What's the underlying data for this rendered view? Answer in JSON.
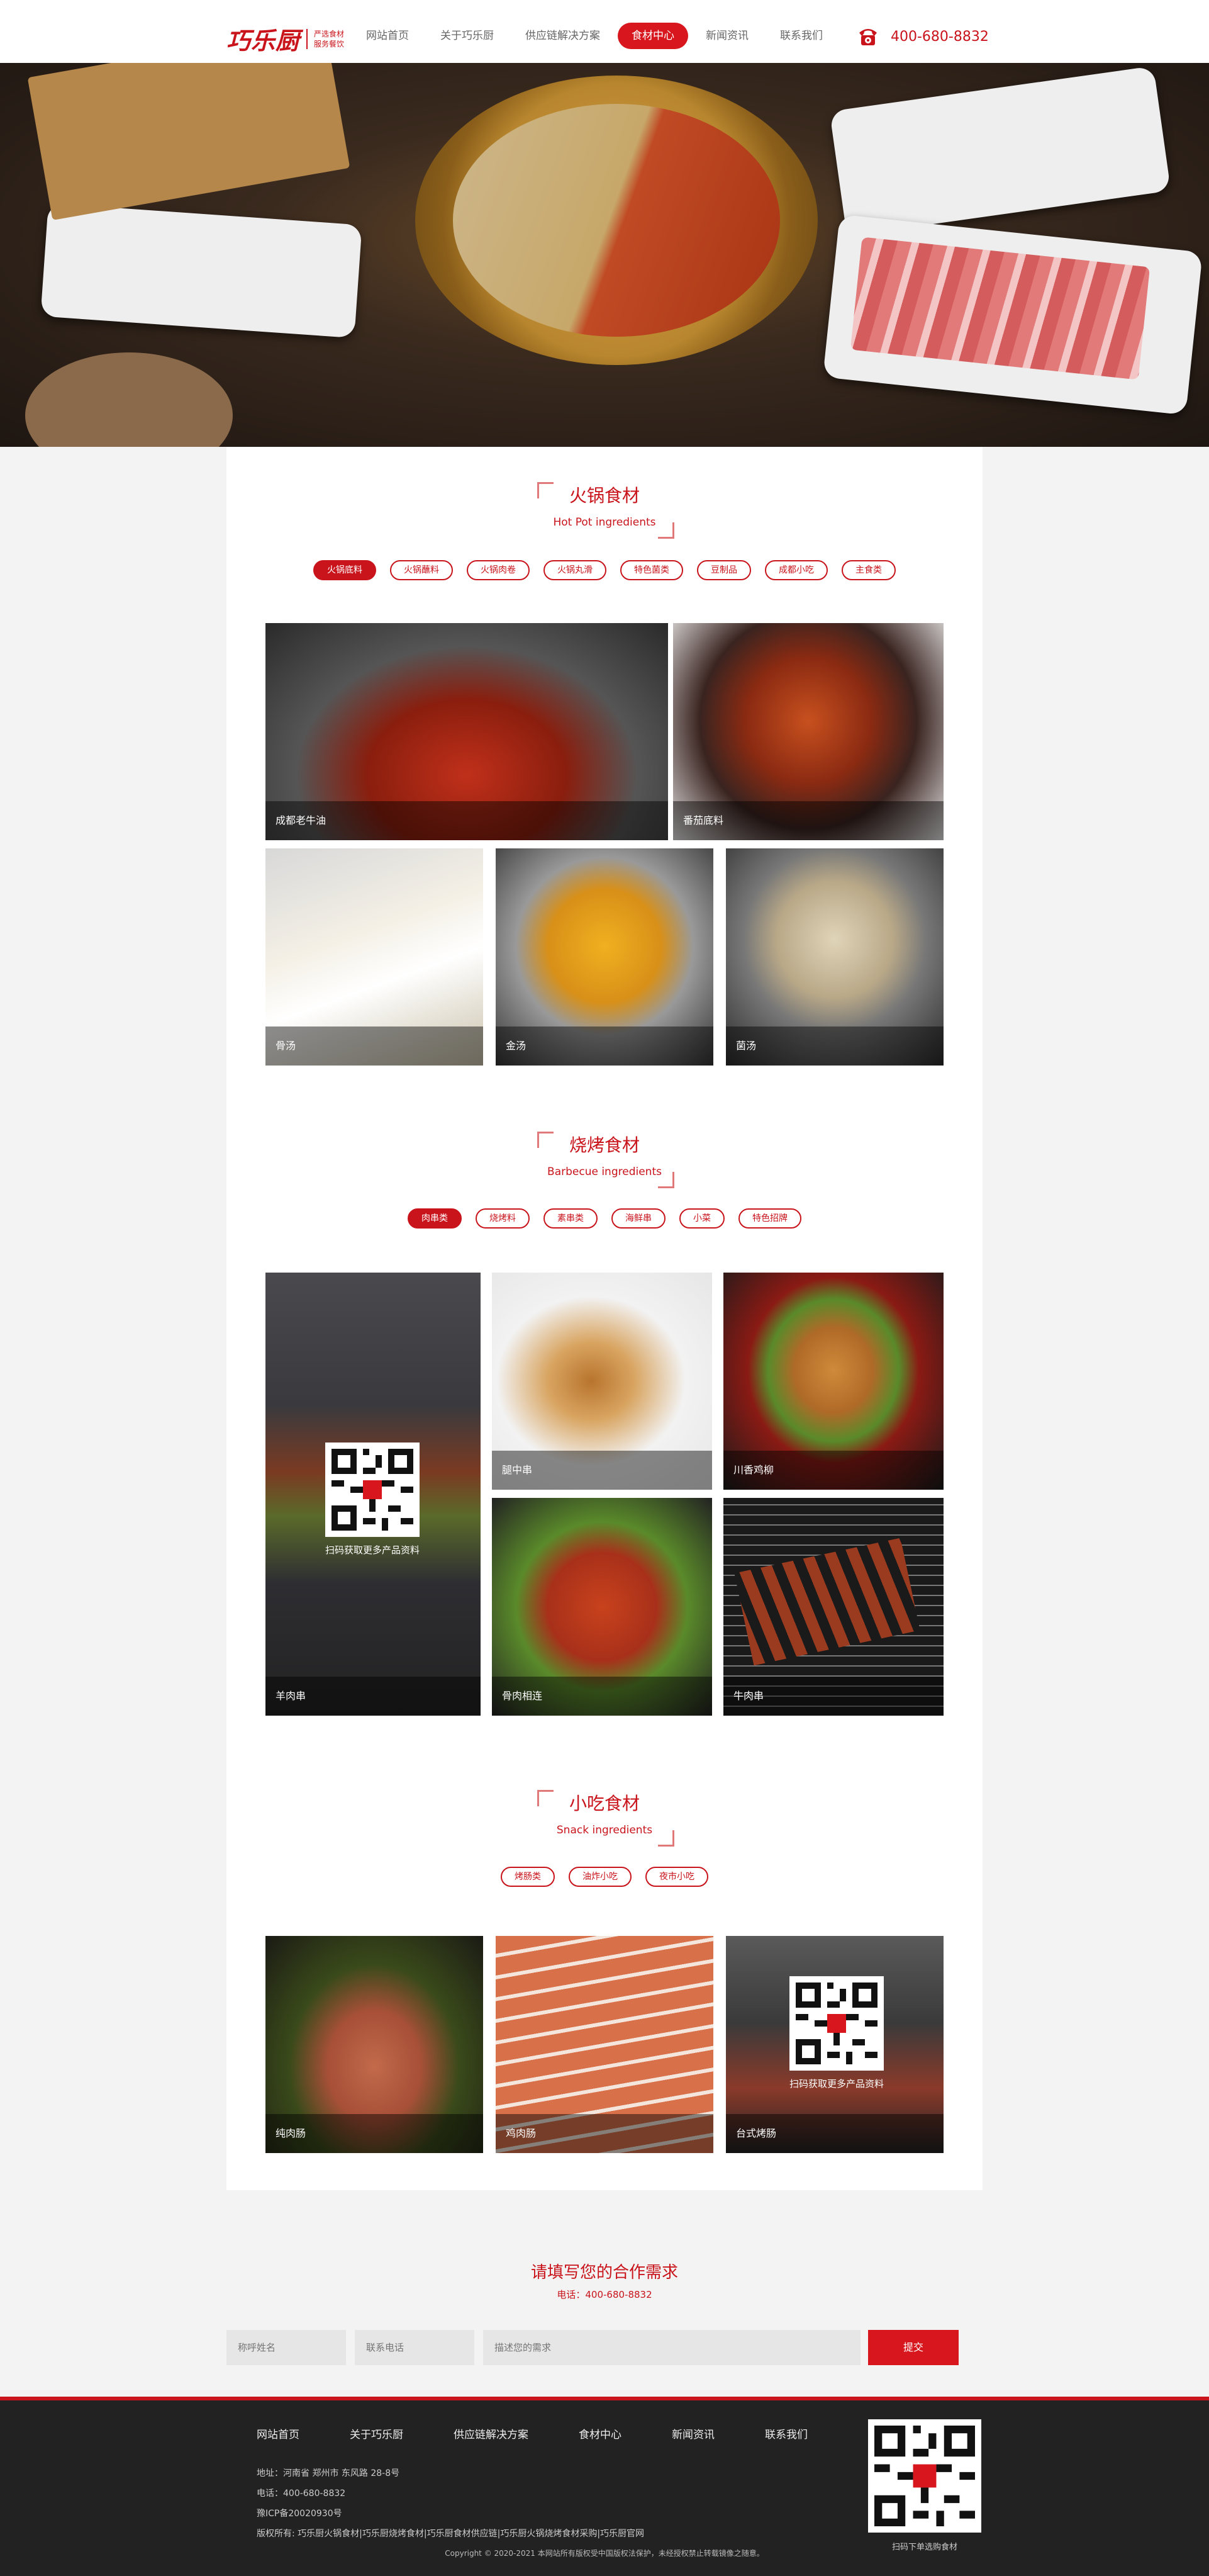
{
  "page": {
    "corner_mark": "→"
  },
  "header": {
    "logo": {
      "main": "巧乐厨",
      "sub_line1": "严选食材",
      "sub_line2": "服务餐饮"
    },
    "nav": [
      {
        "label": "网站首页",
        "active": false
      },
      {
        "label": "关于巧乐厨",
        "active": false
      },
      {
        "label": "供应链解决方案",
        "active": false
      },
      {
        "label": "食材中心",
        "active": true
      },
      {
        "label": "新闻资讯",
        "active": false
      },
      {
        "label": "联系我们",
        "active": false
      }
    ],
    "hotline": "400-680-8832",
    "phone_icon": "phone-icon"
  },
  "colors": {
    "brand_red": "#c9141c",
    "footer_bg": "#222222",
    "content_bg": "#ffffff",
    "page_bg": "#f3f3f3"
  },
  "hotpot": {
    "title_cn": "火锅食材",
    "title_en": "Hot Pot ingredients",
    "tabs": [
      "火锅底料",
      "火锅蘸料",
      "火锅肉卷",
      "火锅丸滑",
      "特色菌类",
      "豆制品",
      "成都小吃",
      "主食类"
    ],
    "active_tab": 0,
    "cards": [
      "成都老牛油",
      "番茄底料",
      "骨汤",
      "金汤",
      "菌汤"
    ]
  },
  "bbq": {
    "title_cn": "烧烤食材",
    "title_en": "Barbecue ingredients",
    "tabs": [
      "肉串类",
      "烧烤料",
      "素串类",
      "海鲜串",
      "小菜",
      "特色招牌"
    ],
    "active_tab": 0,
    "cards": [
      "羊肉串",
      "腿中串",
      "川香鸡柳",
      "骨肉相连",
      "牛肉串"
    ],
    "qr_label": "扫码获取更多产品资料"
  },
  "snack": {
    "title_cn": "小吃食材",
    "title_en": "Snack ingredients",
    "tabs": [
      "烤肠类",
      "油炸小吃",
      "夜市小吃"
    ],
    "cards": [
      "纯肉肠",
      "鸡肉肠",
      "台式烤肠"
    ],
    "qr_label": "扫码获取更多产品资料"
  },
  "contact": {
    "title": "请填写您的合作需求",
    "phone": "电话：400-680-8832",
    "name_placeholder": "称呼姓名",
    "tel_placeholder": "联系电话",
    "needs_placeholder": "描述您的需求",
    "submit": "提交"
  },
  "footer": {
    "nav": [
      "网站首页",
      "关于巧乐厨",
      "供应链解决方案",
      "食材中心",
      "新闻资讯",
      "联系我们"
    ],
    "address": "地址：河南省 郑州市 东风路 28-8号",
    "phone": "电话：400-680-8832",
    "icp": "豫ICP备20020930号",
    "keywords": "版权所有: 巧乐厨火锅食材|巧乐厨烧烤食材|巧乐厨食材供应链|巧乐厨火锅烧烤食材采购|巧乐厨官网",
    "copyright": "Copyright © 2020-2021 本网站所有版权受中国版权法保护，未经授权禁止转载镜像之随意。",
    "qr_label": "扫码下单选购食材"
  }
}
